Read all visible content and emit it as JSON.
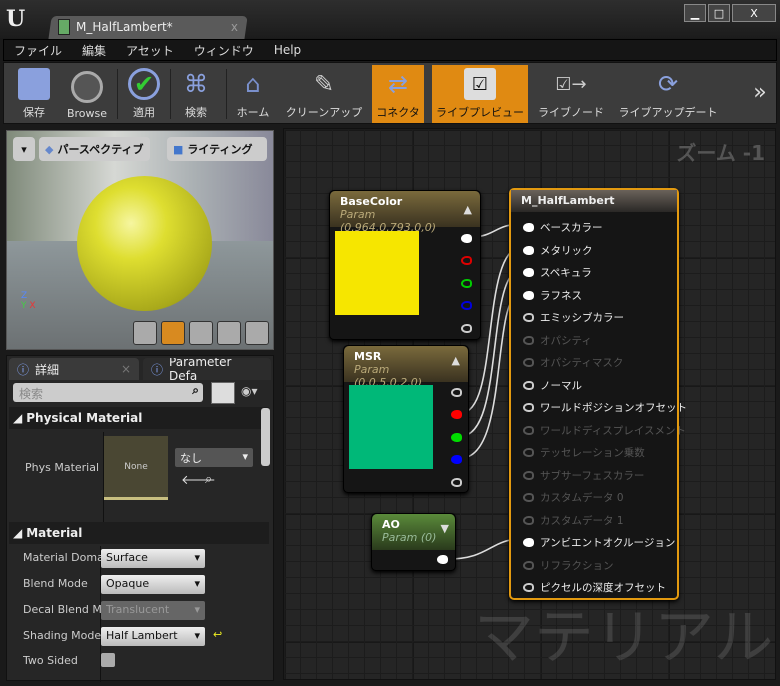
{
  "window": {
    "tab_title": "M_HalfLambert*",
    "minimize": "▁",
    "maximize": "□",
    "close": "X"
  },
  "menu": [
    "ファイル",
    "編集",
    "アセット",
    "ウィンドウ",
    "Help"
  ],
  "toolbar": [
    {
      "label": "保存",
      "icon": "save-icon"
    },
    {
      "label": "Browse",
      "icon": "browse-icon"
    },
    {
      "label": "適用",
      "icon": "apply-icon"
    },
    {
      "label": "検索",
      "icon": "binoculars-icon"
    },
    {
      "label": "ホーム",
      "icon": "home-icon"
    },
    {
      "label": "クリーンアップ",
      "icon": "cleanup-icon"
    },
    {
      "label": "コネクタ",
      "icon": "connector-icon",
      "active": true
    },
    {
      "label": "ライブプレビュー",
      "icon": "tv-icon",
      "active": true
    },
    {
      "label": "ライブノード",
      "icon": "live-node-icon"
    },
    {
      "label": "ライブアップデート",
      "icon": "live-update-icon"
    }
  ],
  "toolbar_more": "»",
  "viewport": {
    "perspective": "パースペクティブ",
    "lighting": "ライティング"
  },
  "details": {
    "tab1": "詳細",
    "tab2": "Parameter Defa",
    "search_placeholder": "検索",
    "physical": {
      "title": "Physical Material",
      "label": "Phys Material",
      "thumb": "None",
      "value": "なし"
    },
    "material": {
      "title": "Material",
      "props": [
        {
          "label": "Material Doma",
          "value": "Surface"
        },
        {
          "label": "Blend Mode",
          "value": "Opaque"
        },
        {
          "label": "Decal Blend M",
          "value": "Translucent",
          "disabled": true
        },
        {
          "label": "Shading Mode",
          "value": "Half Lambert"
        }
      ],
      "two_sided": "Two Sided"
    }
  },
  "graph": {
    "zoom": "ズーム -1",
    "watermark": "マテリアル",
    "nodes": {
      "basecolor": {
        "title": "BaseColor",
        "sub": "Param (0.964,0.793,0,0)",
        "color": "#f6e600"
      },
      "msr": {
        "title": "MSR",
        "sub": "Param (0,0.5,0.2,0)",
        "color": "#00b878"
      },
      "ao": {
        "title": "AO",
        "sub": "Param (0)"
      },
      "result": {
        "title": "M_HalfLambert",
        "inputs": [
          {
            "label": "ベースカラー",
            "on": true,
            "connected": true
          },
          {
            "label": "メタリック",
            "on": true,
            "connected": true
          },
          {
            "label": "スペキュラ",
            "on": true,
            "connected": true
          },
          {
            "label": "ラフネス",
            "on": true,
            "connected": true
          },
          {
            "label": "エミッシブカラー",
            "on": true
          },
          {
            "label": "オパシティ",
            "on": false
          },
          {
            "label": "オパシティマスク",
            "on": false
          },
          {
            "label": "ノーマル",
            "on": true
          },
          {
            "label": "ワールドポジションオフセット",
            "on": true
          },
          {
            "label": "ワールドディスプレイスメント",
            "on": false
          },
          {
            "label": "テッセレーション乗数",
            "on": false
          },
          {
            "label": "サブサーフェスカラー",
            "on": false
          },
          {
            "label": "カスタムデータ 0",
            "on": false
          },
          {
            "label": "カスタムデータ 1",
            "on": false
          },
          {
            "label": "アンビエントオクルージョン",
            "on": true,
            "connected": true
          },
          {
            "label": "リフラクション",
            "on": false
          },
          {
            "label": "ピクセルの深度オフセット",
            "on": true
          }
        ]
      }
    }
  }
}
